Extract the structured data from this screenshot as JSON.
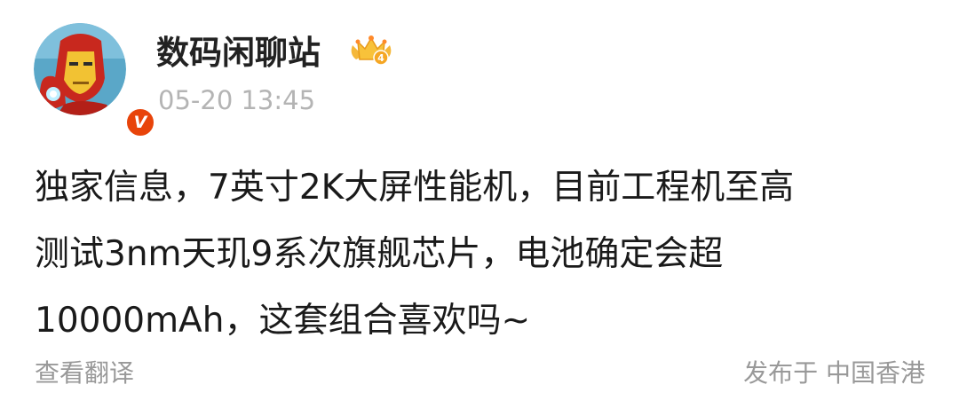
{
  "post": {
    "author": {
      "name": "数码闲聊站",
      "verified_mark": "V",
      "avatar_icon": "iron-man-avatar",
      "rank_icon": "crown-level-badge-icon",
      "rank_level": "4"
    },
    "timestamp": "05-20 13:45",
    "content_lines": [
      "独家信息，7英寸2K大屏性能机，目前工程机至高",
      "测试3nm天玑9系次旗舰芯片，电池确定会超",
      "10000mAh，这套组合喜欢吗~"
    ],
    "footer": {
      "translate_label": "查看翻译",
      "location_label": "发布于 中国香港"
    }
  },
  "colors": {
    "verified_badge": "#e8440a",
    "secondary_text": "#999999",
    "timestamp_text": "#b4b4b4",
    "primary_text": "#1a1a1a"
  }
}
